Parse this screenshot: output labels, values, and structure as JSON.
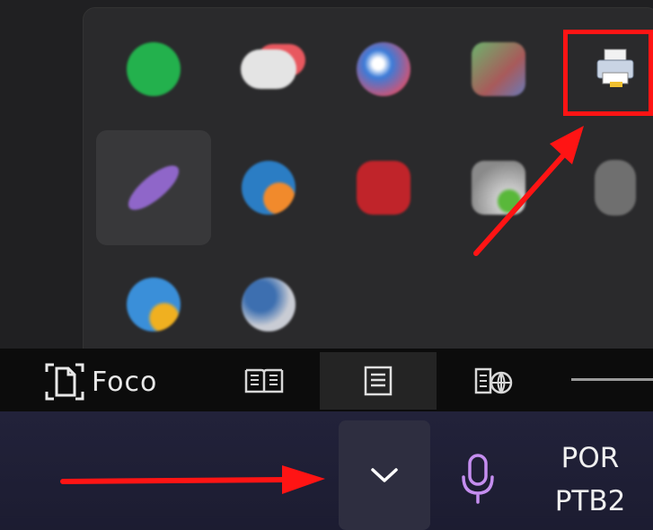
{
  "tray_overflow": {
    "icons": [
      {
        "name": "spotify-icon",
        "color": "#1db954"
      },
      {
        "name": "cloud-sync-icon",
        "color": "#e9e9e9"
      },
      {
        "name": "browser-app-icon",
        "color": "#3b7bd8"
      },
      {
        "name": "colorful-app-icon",
        "color": "#8a9a8a"
      },
      {
        "name": "printer-icon",
        "color": "#cfd8e6"
      },
      {
        "name": "purple-feather-icon",
        "color": "#8f66c9"
      },
      {
        "name": "blue-orange-app-icon",
        "color": "#2b7dc4"
      },
      {
        "name": "red-app-icon",
        "color": "#c0242a"
      },
      {
        "name": "gray-green-app-icon",
        "color": "#b8b8b8"
      },
      {
        "name": "gray-lock-icon",
        "color": "#7a7a7a"
      },
      {
        "name": "blue-yellow-app-icon",
        "color": "#3a8fd9"
      },
      {
        "name": "blue-gray-app-icon",
        "color": "#3d6fb0"
      }
    ]
  },
  "word_status": {
    "focus_label": "Foco"
  },
  "taskbar": {
    "language": "POR",
    "keyboard": "PTB2"
  },
  "colors": {
    "annotation": "#ff1414",
    "mic": "#c58ef0"
  }
}
